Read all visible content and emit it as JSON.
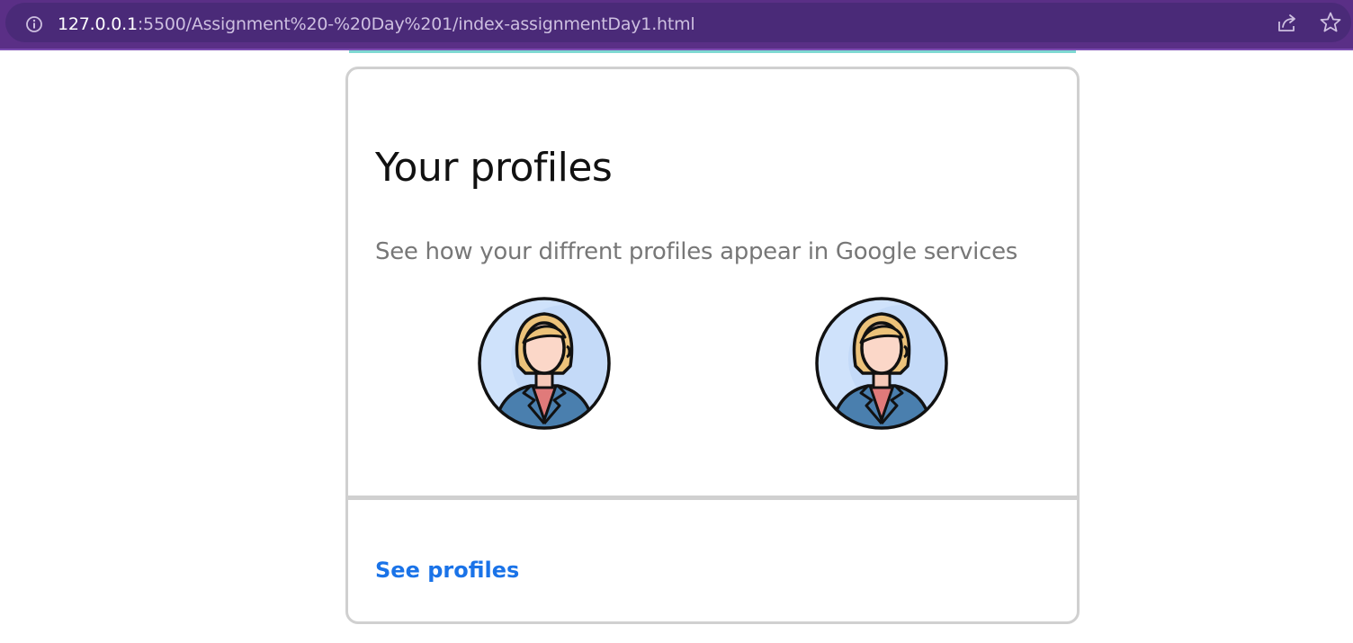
{
  "browser": {
    "url_host": "127.0.0.1",
    "url_rest": ":5500/Assignment%20-%20Day%201/index-assignmentDay1.html",
    "info_icon": "info-icon",
    "share_icon": "share-icon",
    "star_icon": "star-icon"
  },
  "card": {
    "title": "Your profiles",
    "subtitle": "See how your diffrent profiles appear in Google services",
    "avatars": [
      {
        "icon": "female-avatar-icon"
      },
      {
        "icon": "female-avatar-icon"
      }
    ],
    "link_label": "See profiles"
  },
  "colors": {
    "browser_bar": "#5a2f86",
    "link": "#1a73e8",
    "subtitle": "#777777",
    "card_border": "#d0d0d0"
  }
}
